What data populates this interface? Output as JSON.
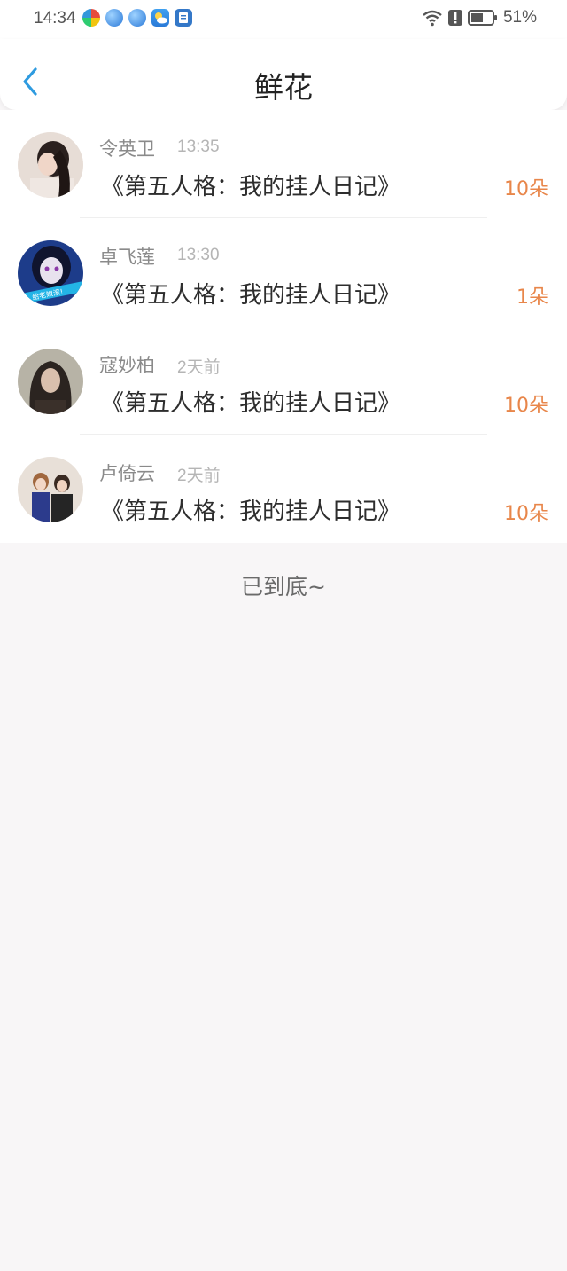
{
  "status_bar": {
    "time": "14:34",
    "battery_percent": "51%",
    "app_icons": [
      "multicolor-app-icon",
      "blue-sphere-icon",
      "blue-sphere-icon",
      "weather-icon",
      "document-icon"
    ]
  },
  "header": {
    "title": "鲜花",
    "back_icon": "chevron-left-icon"
  },
  "items": [
    {
      "user": "令英卫",
      "time": "13:35",
      "book": "《第五人格：我的挂人日记》",
      "count": "10朵"
    },
    {
      "user": "卓飞莲",
      "time": "13:30",
      "book": "《第五人格：我的挂人日记》",
      "count": "1朵"
    },
    {
      "user": "寇妙柏",
      "time": "2天前",
      "book": "《第五人格：我的挂人日记》",
      "count": "10朵"
    },
    {
      "user": "卢倚云",
      "time": "2天前",
      "book": "《第五人格：我的挂人日记》",
      "count": "10朵"
    }
  ],
  "footer": {
    "end_text": "已到底~"
  },
  "colors": {
    "accent": "#2e9be0",
    "count": "#e8864a",
    "background": "#f8f6f7"
  }
}
